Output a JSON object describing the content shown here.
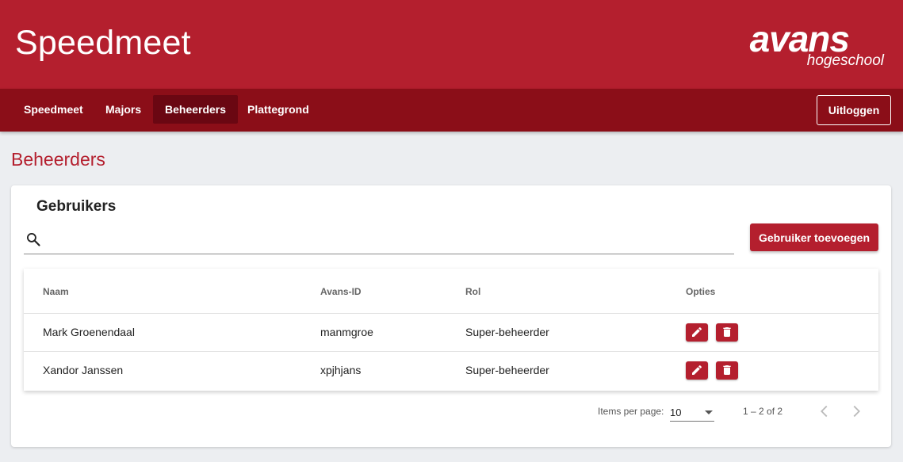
{
  "header": {
    "app_title": "Speedmeet",
    "logo_main": "avans",
    "logo_sub": "hogeschool"
  },
  "nav": {
    "items": [
      {
        "label": "Speedmeet"
      },
      {
        "label": "Majors"
      },
      {
        "label": "Beheerders",
        "active": true
      },
      {
        "label": "Plattegrond"
      }
    ],
    "logout_label": "Uitloggen"
  },
  "page": {
    "title": "Beheerders"
  },
  "card": {
    "title": "Gebruikers",
    "search_value": "",
    "search_icon": "search-icon",
    "add_button_label": "Gebruiker toevoegen"
  },
  "table": {
    "headers": [
      "Naam",
      "Avans-ID",
      "Rol",
      "Opties"
    ],
    "rows": [
      {
        "name": "Mark Groenendaal",
        "avans_id": "manmgroe",
        "role": "Super-beheerder",
        "actions": [
          "edit-icon",
          "delete-icon"
        ]
      },
      {
        "name": "Xandor Janssen",
        "avans_id": "xpjhjans",
        "role": "Super-beheerder",
        "actions": [
          "edit-icon",
          "delete-icon"
        ]
      }
    ]
  },
  "paginator": {
    "items_per_page_label": "Items per page:",
    "page_size": "10",
    "range_label": "1 – 2 of 2"
  },
  "colors": {
    "brand": "#b41f2e",
    "nav": "#8b0e18",
    "nav_active": "#6a0712",
    "background": "#eceef1"
  }
}
